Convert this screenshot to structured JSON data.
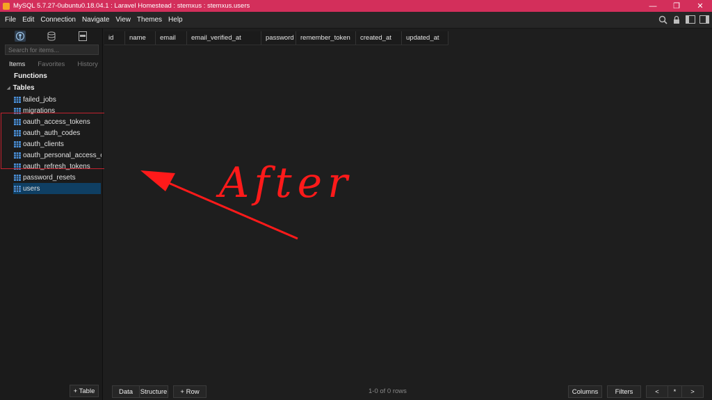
{
  "window": {
    "title": "MySQL 5.7.27-0ubuntu0.18.04.1 : Laravel Homestead : stemxus : stemxus.users",
    "minimize": "—",
    "restore": "❐",
    "close": "✕"
  },
  "menu": [
    "File",
    "Edit",
    "Connection",
    "Navigate",
    "View",
    "Themes",
    "Help"
  ],
  "sidebar": {
    "search_placeholder": "Search for items...",
    "tabs": [
      "Items",
      "Favorites",
      "History"
    ],
    "functions_label": "Functions",
    "tables_label": "Tables",
    "tables": [
      {
        "name": "failed_jobs",
        "selected": false
      },
      {
        "name": "migrations",
        "selected": false
      },
      {
        "name": "oauth_access_tokens",
        "selected": false
      },
      {
        "name": "oauth_auth_codes",
        "selected": false
      },
      {
        "name": "oauth_clients",
        "selected": false
      },
      {
        "name": "oauth_personal_access_clients",
        "selected": false
      },
      {
        "name": "oauth_refresh_tokens",
        "selected": false
      },
      {
        "name": "password_resets",
        "selected": false
      },
      {
        "name": "users",
        "selected": true
      }
    ],
    "add_table_label": "+ Table"
  },
  "grid": {
    "columns": [
      "id",
      "name",
      "email",
      "email_verified_at",
      "password",
      "remember_token",
      "created_at",
      "updated_at"
    ]
  },
  "bottom": {
    "data_label": "Data",
    "structure_label": "Structure",
    "add_row_label": "+ Row",
    "rows_info": "1-0 of 0 rows",
    "columns_label": "Columns",
    "filters_label": "Filters",
    "prev_label": "<",
    "all_label": "*",
    "next_label": ">"
  },
  "annotation": {
    "text": "After",
    "color": "#ff1a1a"
  },
  "colors": {
    "titlebar": "#d32f5b",
    "selection": "#0f3f63",
    "table_icon": "#4a90d9"
  }
}
